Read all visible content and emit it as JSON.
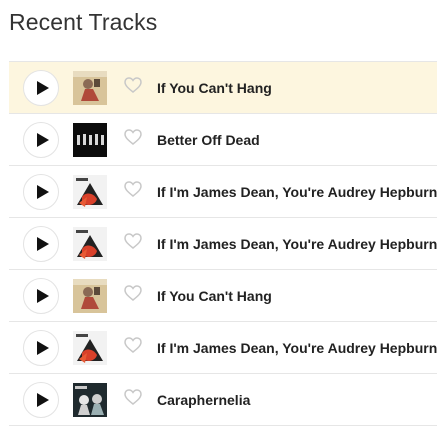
{
  "header": {
    "title": "Recent Tracks"
  },
  "colors": {
    "highlight_row": "#fdf6df",
    "divider": "#e6e6e6",
    "title_text": "#333333",
    "track_text": "#222222"
  },
  "tracks": [
    {
      "name": "If You Can't Hang",
      "artwork": "tan-cover-figure",
      "highlighted": true,
      "play_icon": "play-icon",
      "love_icon": "heart-outline-icon"
    },
    {
      "name": "Better Off Dead",
      "artwork": "black-cover-figures",
      "highlighted": false,
      "play_icon": "play-icon",
      "love_icon": "heart-outline-icon"
    },
    {
      "name": "If I'm James Dean, You're Audrey Hepburn",
      "artwork": "white-cover-red-shape",
      "highlighted": false,
      "play_icon": "play-icon",
      "love_icon": "heart-outline-icon"
    },
    {
      "name": "If I'm James Dean, You're Audrey Hepburn",
      "artwork": "white-cover-red-shape",
      "highlighted": false,
      "play_icon": "play-icon",
      "love_icon": "heart-outline-icon"
    },
    {
      "name": "If You Can't Hang",
      "artwork": "tan-cover-figure",
      "highlighted": false,
      "play_icon": "play-icon",
      "love_icon": "heart-outline-icon"
    },
    {
      "name": "If I'm James Dean, You're Audrey Hepburn",
      "artwork": "white-cover-red-shape",
      "highlighted": false,
      "play_icon": "play-icon",
      "love_icon": "heart-outline-icon"
    },
    {
      "name": "Caraphernelia",
      "artwork": "dark-cover-figures",
      "highlighted": false,
      "play_icon": "play-icon",
      "love_icon": "heart-outline-icon"
    }
  ]
}
